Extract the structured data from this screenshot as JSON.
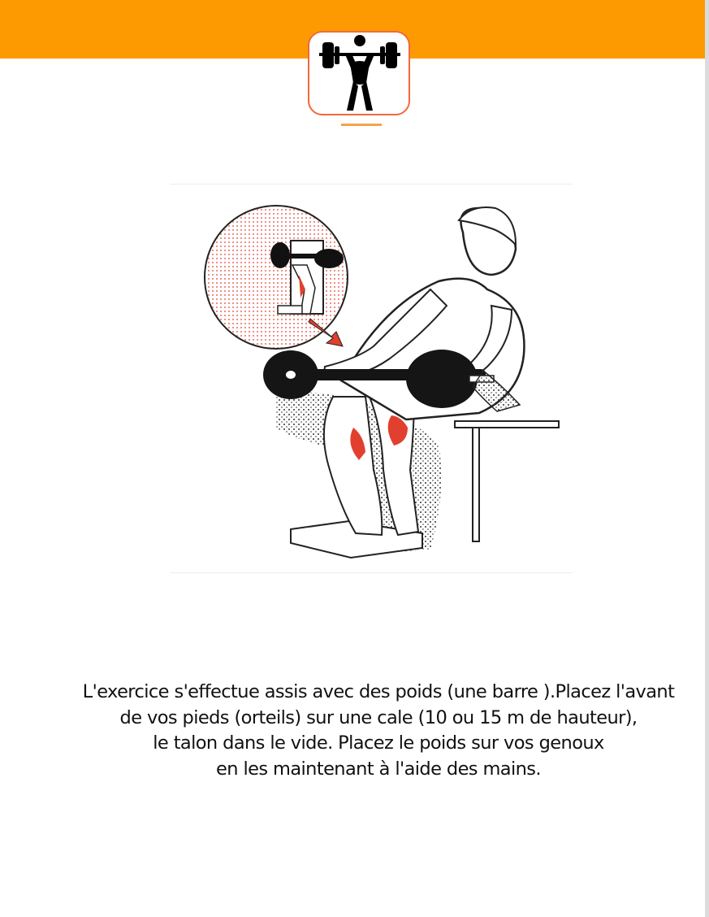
{
  "header": {
    "bar_color": "#fd9a02",
    "logo_icon": "weightlifter-icon",
    "logo_border_color": "#f2683c"
  },
  "illustration": {
    "icon": "seated-calf-raise-illustration",
    "muscle_highlight_color": "#e1402e"
  },
  "instructions": {
    "line1": "L'exercice s'effectue assis avec des poids (une barre ).Placez l'avant",
    "line2": "de vos pieds (orteils) sur une cale (10 ou 15 m de hauteur),",
    "line3": "le talon dans le vide. Placez le poids sur vos genoux",
    "line4": "en les maintenant à l'aide des mains."
  }
}
